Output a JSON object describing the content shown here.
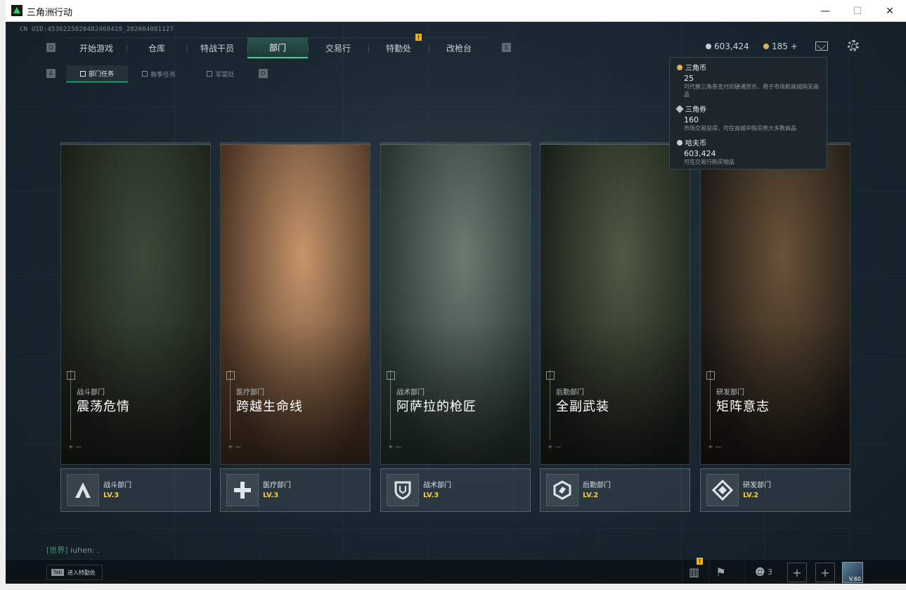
{
  "window": {
    "title": "三角洲行动",
    "minimize_glyph": "—",
    "maximize_glyph": "☐",
    "close_glyph": "✕"
  },
  "uid": "CN UID:4536225820482469419_202604081127",
  "nav": {
    "left_key": "Q",
    "right_key": "E",
    "items": [
      {
        "label": "开始游戏"
      },
      {
        "label": "仓库"
      },
      {
        "label": "特战干员"
      },
      {
        "label": "部门",
        "active": true
      },
      {
        "label": "交易行"
      },
      {
        "label": "特勤处",
        "badge": "!"
      },
      {
        "label": "改枪台"
      }
    ]
  },
  "subnav": {
    "left_key": "A",
    "right_key": "D",
    "items": [
      {
        "label": "部门任务",
        "active": true
      },
      {
        "label": "赛季任务"
      },
      {
        "label": "军需处"
      }
    ]
  },
  "currency": {
    "haf_value": "603,424",
    "triangle_value": "185",
    "add_glyph": "+"
  },
  "tooltip": {
    "items": [
      {
        "name": "三角币",
        "value": "25",
        "desc": "可代替三角券支付的硬通货币，用于市场和商城购买商品",
        "color": "#d8b25a"
      },
      {
        "name": "三角券",
        "value": "160",
        "desc": "市场交易获得，可在商城中购买绝大多数商品",
        "color": "#b9c3c8"
      },
      {
        "name": "哈夫币",
        "value": "603,424",
        "desc": "可在交易行购买物品",
        "color": "#c9cfd3"
      }
    ]
  },
  "cards": [
    {
      "dept": "战斗部门",
      "name": "震荡危情",
      "level": "LV.3",
      "icon": "combat-a-icon",
      "colors": [
        "#3c4a3a",
        "#1c2118"
      ]
    },
    {
      "dept": "医疗部门",
      "name": "跨越生命线",
      "level": "LV.3",
      "icon": "medical-cross-icon",
      "colors": [
        "#c7956a",
        "#4a3424"
      ]
    },
    {
      "dept": "战术部门",
      "name": "阿萨拉的枪匠",
      "level": "LV.3",
      "icon": "tactical-shield-icon",
      "colors": [
        "#6d7a70",
        "#273631"
      ]
    },
    {
      "dept": "后勤部门",
      "name": "全副武装",
      "level": "LV.2",
      "icon": "logistics-hex-icon",
      "colors": [
        "#4f5a43",
        "#1a2019"
      ]
    },
    {
      "dept": "研发部门",
      "name": "矩阵意志",
      "level": "LV.2",
      "icon": "research-diamond-icon",
      "colors": [
        "#6a5238",
        "#1e1a16"
      ]
    }
  ],
  "chat": {
    "channel": "[世界]",
    "name": "iuhen:",
    "text": "."
  },
  "bottombar": {
    "tab_key": "Tab",
    "tab_label": "进入特勤处",
    "stats_badge": "!",
    "friends_count": "3",
    "plus_glyph": "+",
    "avatar_label": "V.60"
  }
}
